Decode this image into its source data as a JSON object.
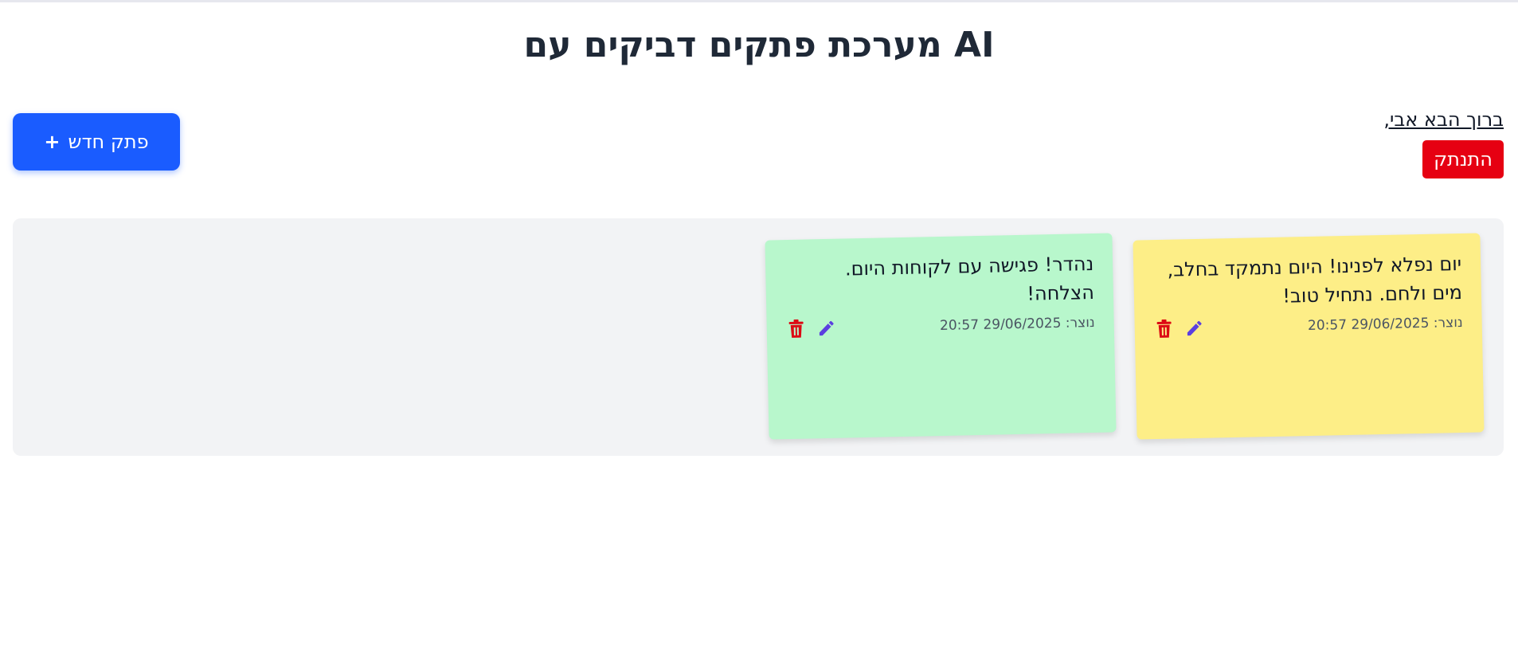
{
  "app": {
    "title": "מערכת פתקים דביקים עם AI"
  },
  "user": {
    "welcome": "ברוך הבא אבי,",
    "logout_label": "התנתק"
  },
  "toolbar": {
    "new_note_label": "פתק חדש",
    "new_note_icon": "+"
  },
  "colors": {
    "primary": "#1a5cff",
    "danger": "#e60012",
    "board_bg": "#f2f3f5",
    "edit_icon": "#5b3fe0",
    "delete_icon": "#dc0a14"
  },
  "notes": [
    {
      "text_line1": "יום נפלא לפנינו! היום נתמקד בחלב,",
      "text_line2": "מים ולחם. נתחיל טוב!",
      "created": "נוצר: 29/06/2025 20:57",
      "color": "#fdee87",
      "edit_icon": "pencil-icon",
      "delete_icon": "trash-icon"
    },
    {
      "text_line1": "נהדר! פגישה עם לקוחות היום.",
      "text_line2": "הצלחה!",
      "created": "נוצר: 29/06/2025 20:57",
      "color": "#b8f7cc",
      "edit_icon": "pencil-icon",
      "delete_icon": "trash-icon"
    }
  ]
}
